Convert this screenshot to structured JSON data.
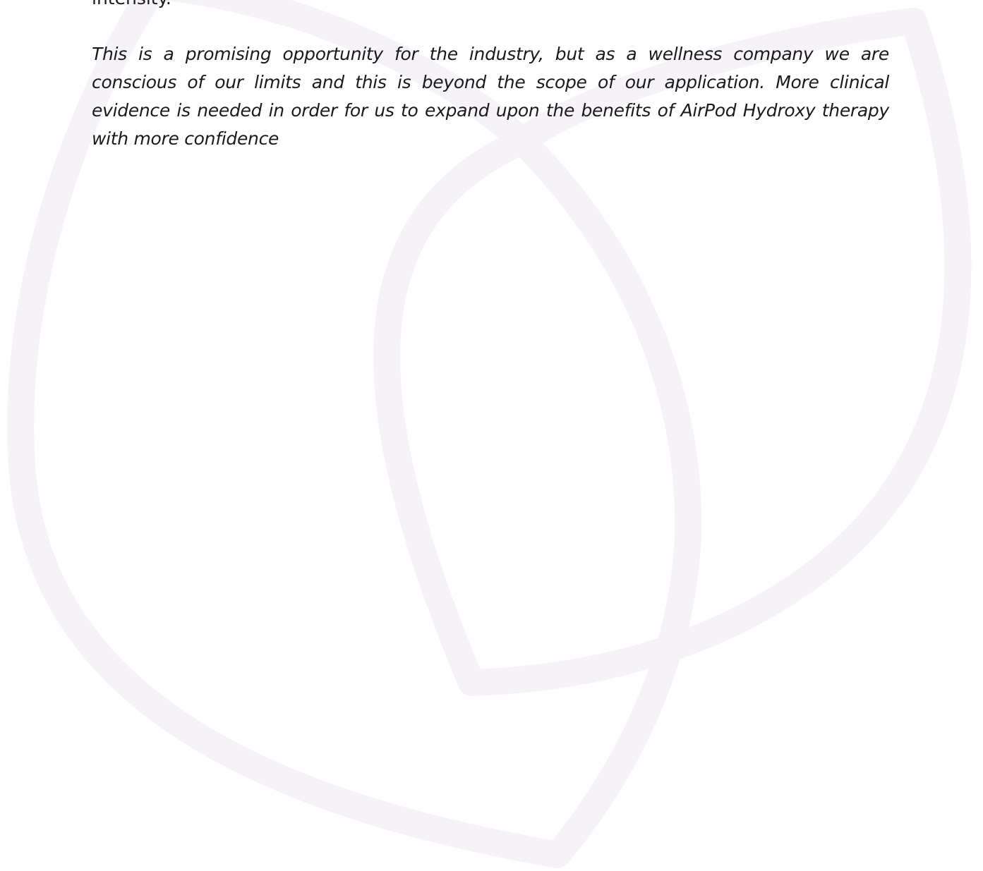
{
  "document": {
    "cut_off_line": "intensity.",
    "note_paragraph": "This is a promising opportunity for the industry, but as a wellness company we are conscious of our limits and this is beyond the scope of our application. More clinical evidence is needed in order for us to expand upon the benefits of AirPod Hydroxy therapy with more confidence"
  },
  "watermark": {
    "icon": "leaf-logo-icon",
    "color": "#f5f3f8"
  }
}
